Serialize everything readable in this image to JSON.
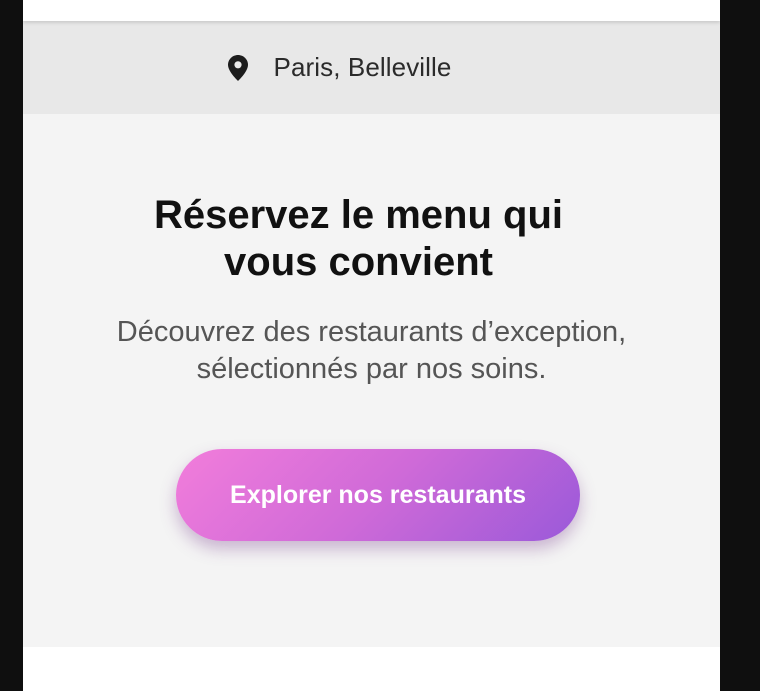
{
  "location": {
    "icon": "location-pin-icon",
    "label": "Paris, Belleville"
  },
  "hero": {
    "title": "Réservez le menu qui vous convient",
    "subtitle": "Découvrez des restaurants d’exception, sélectionnés par nos soins.",
    "cta_label": "Explorer nos restaurants"
  },
  "colors": {
    "gradient_start": "#f27ddb",
    "gradient_end": "#9a59d9",
    "location_bar_bg": "#e8e8e8",
    "hero_bg": "#f4f4f4",
    "outer_bg": "#0f0f0f"
  }
}
